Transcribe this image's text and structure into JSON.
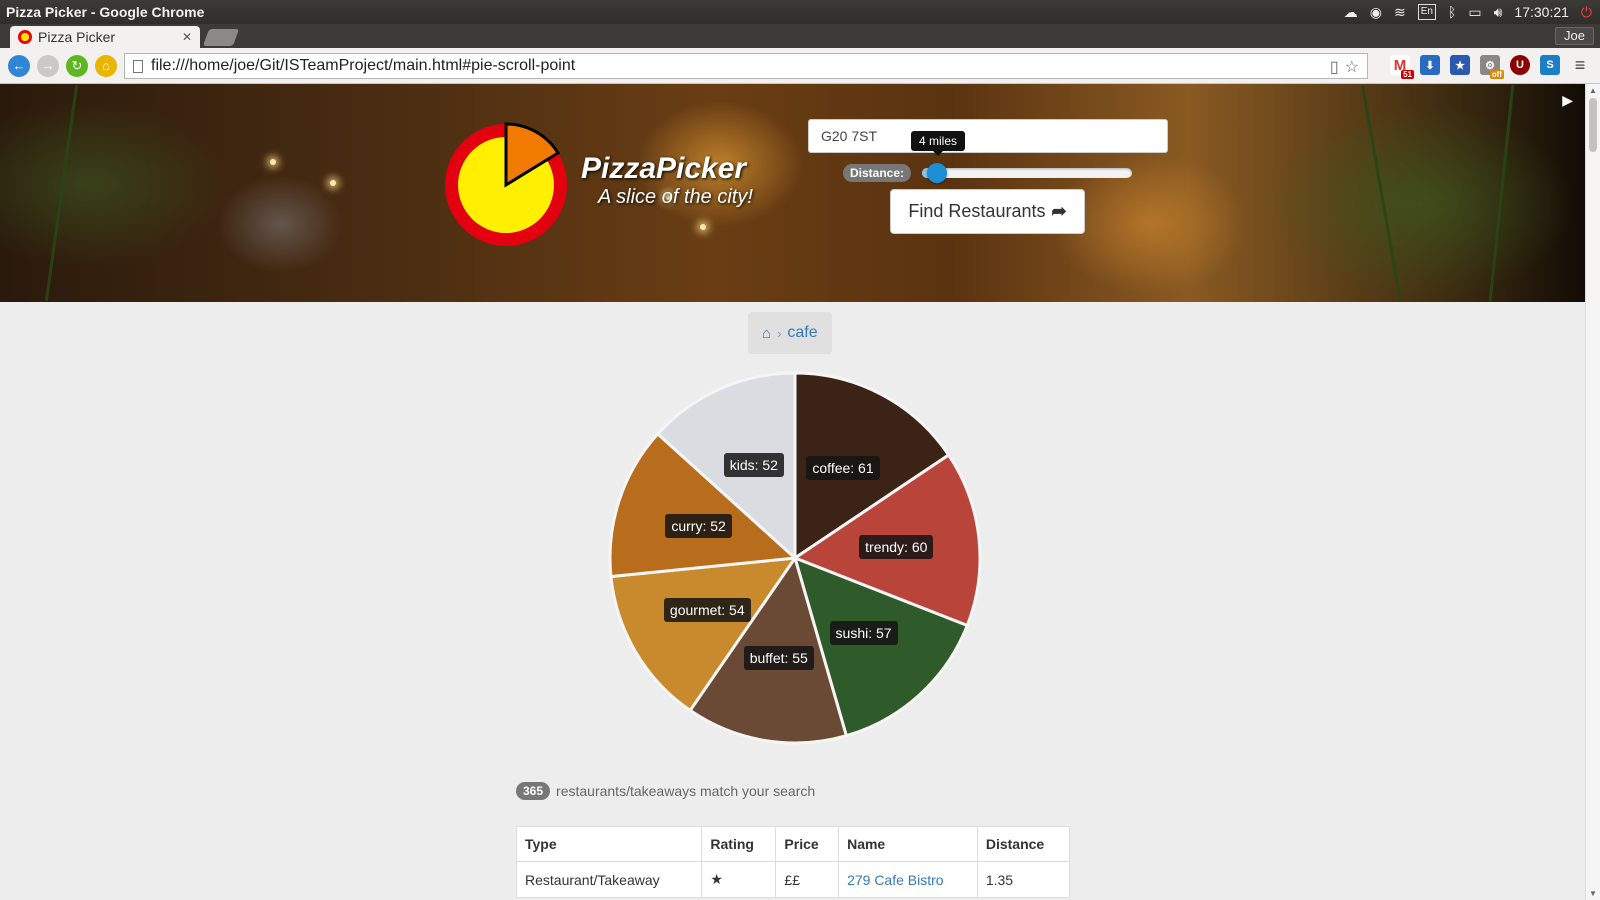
{
  "os": {
    "window_title": "Pizza Picker - Google Chrome",
    "clock": "17:30:21",
    "lang": "En",
    "user": "Joe"
  },
  "browser": {
    "tab_title": "Pizza Picker",
    "url": "file:///home/joe/Git/ISTeamProject/main.html#pie-scroll-point",
    "gmail_badge": "51",
    "ext_off_badge": "off",
    "ext_u": "U",
    "ext_s": "S"
  },
  "hero": {
    "brand": "PizzaPicker",
    "tagline": "A slice of the city!",
    "postcode_value": "G20 7ST",
    "distance_label": "Distance:",
    "distance_tooltip": "4 miles",
    "distance_fraction": 0.07,
    "find_button": "Find Restaurants"
  },
  "breadcrumb": {
    "current": "cafe"
  },
  "chart_data": {
    "type": "pie",
    "categories": [
      "coffee",
      "trendy",
      "sushi",
      "buffet",
      "gourmet",
      "curry",
      "kids"
    ],
    "values": [
      61,
      60,
      57,
      55,
      54,
      52,
      52
    ],
    "tooltips": [
      "coffee: 61",
      "trendy: 60",
      "sushi: 57",
      "buffet: 55",
      "gourmet: 54",
      "curry: 52",
      "kids: 52"
    ],
    "colors": [
      "#3b2416",
      "#b8443a",
      "#2f5a2a",
      "#6b4a35",
      "#c98a2e",
      "#b86d1c",
      "#d9dde2"
    ]
  },
  "results": {
    "count": "365",
    "summary": "restaurants/takeaways match your search",
    "columns": [
      "Type",
      "Rating",
      "Price",
      "Name",
      "Distance"
    ],
    "rows": [
      {
        "type": "Restaurant/Takeaway",
        "rating": "★",
        "price": "££",
        "name": "279 Cafe Bistro",
        "distance": "1.35"
      }
    ]
  }
}
